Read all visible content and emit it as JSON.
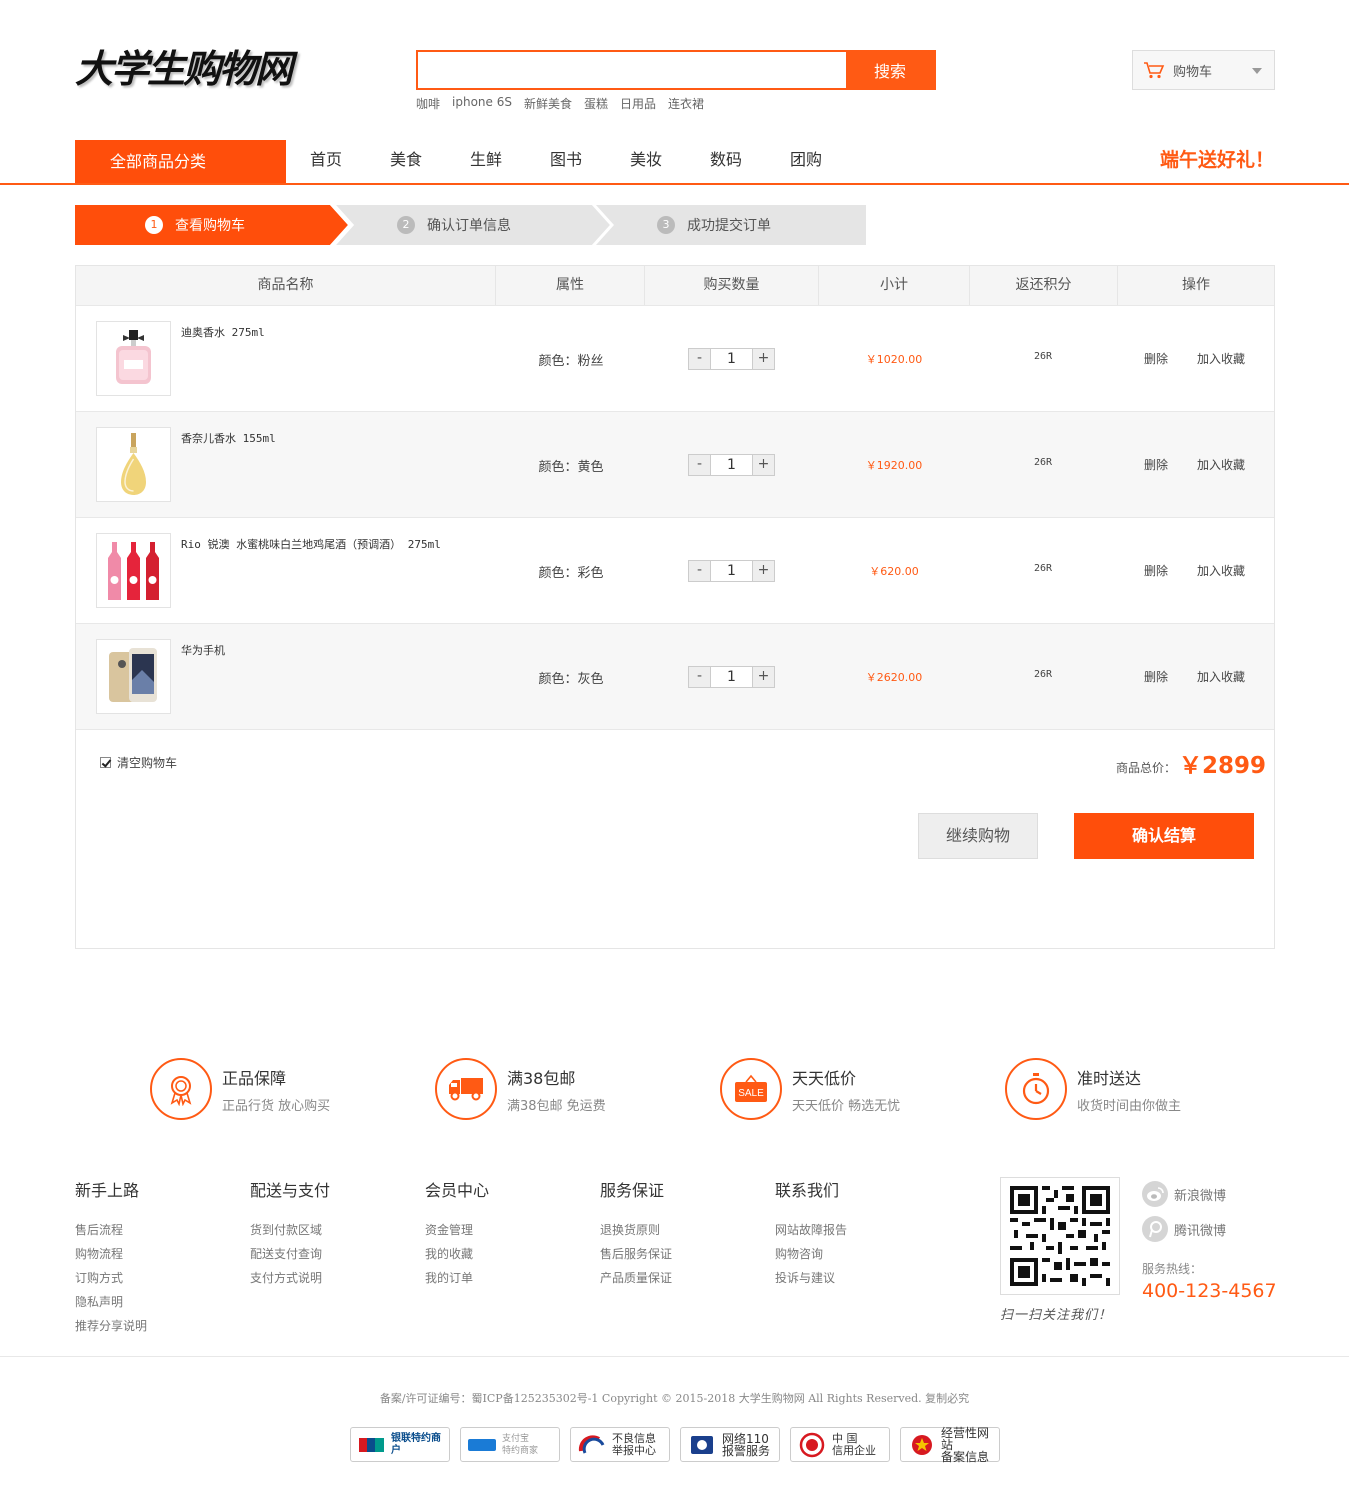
{
  "header": {
    "logo": "大学生购物网",
    "search_placeholder": "",
    "search_button": "搜索",
    "hot_words": [
      "咖啡",
      "iphone 6S",
      "新鲜美食",
      "蛋糕",
      "日用品",
      "连衣裙"
    ],
    "cart_label": "购物车"
  },
  "nav": {
    "all_categories": "全部商品分类",
    "items": [
      "首页",
      "美食",
      "生鲜",
      "图书",
      "美妆",
      "数码",
      "团购"
    ],
    "promo": "端午送好礼！"
  },
  "steps": [
    {
      "num": "1",
      "label": "查看购物车"
    },
    {
      "num": "2",
      "label": "确认订单信息"
    },
    {
      "num": "3",
      "label": "成功提交订单"
    }
  ],
  "cart": {
    "columns": [
      "商品名称",
      "属性",
      "购买数量",
      "小计",
      "返还积分",
      "操作"
    ],
    "items": [
      {
        "name": "迪奥香水 275ml",
        "attr": "颜色：粉丝",
        "qty": "1",
        "subtotal": "￥1020.00",
        "points": "26R",
        "delete": "删除",
        "favorite": "加入收藏"
      },
      {
        "name": "香奈儿香水 155ml",
        "attr": "颜色：黄色",
        "qty": "1",
        "subtotal": "￥1920.00",
        "points": "26R",
        "delete": "删除",
        "favorite": "加入收藏"
      },
      {
        "name": "Rio 锐澳 水蜜桃味白兰地鸡尾酒（预调酒） 275ml",
        "attr": "颜色：彩色",
        "qty": "1",
        "subtotal": "￥620.00",
        "points": "26R",
        "delete": "删除",
        "favorite": "加入收藏"
      },
      {
        "name": "华为手机",
        "attr": "颜色：灰色",
        "qty": "1",
        "subtotal": "￥2620.00",
        "points": "26R",
        "delete": "删除",
        "favorite": "加入收藏"
      }
    ],
    "minus": "-",
    "plus": "+",
    "clear_label": "清空购物车",
    "total_label": "商品总价：",
    "total_value": "￥2899",
    "continue_button": "继续购物",
    "confirm_button": "确认结算"
  },
  "guarantees": [
    {
      "title": "正品保障",
      "sub": "正品行货 放心购买",
      "icon": "medal-icon"
    },
    {
      "title": "满38包邮",
      "sub": "满38包邮 免运费",
      "icon": "truck-icon"
    },
    {
      "title": "天天低价",
      "sub": "天天低价 畅选无忧",
      "icon": "sale-tag-icon",
      "icon_text": "SALE"
    },
    {
      "title": "准时送达",
      "sub": "收货时间由你做主",
      "icon": "stopwatch-icon"
    }
  ],
  "footer": {
    "columns": [
      {
        "title": "新手上路",
        "links": [
          "售后流程",
          "购物流程",
          "订购方式",
          "隐私声明",
          "推荐分享说明"
        ]
      },
      {
        "title": "配送与支付",
        "links": [
          "货到付款区域",
          "配送支付查询",
          "支付方式说明"
        ]
      },
      {
        "title": "会员中心",
        "links": [
          "资金管理",
          "我的收藏",
          "我的订单"
        ]
      },
      {
        "title": "服务保证",
        "links": [
          "退换货原则",
          "售后服务保证",
          "产品质量保证"
        ]
      },
      {
        "title": "联系我们",
        "links": [
          "网站故障报告",
          "购物咨询",
          "投诉与建议"
        ]
      }
    ],
    "qr_caption": "扫一扫关注我们！",
    "weibo_sina": "新浪微博",
    "weibo_tencent": "腾讯微博",
    "hotline_label": "服务热线：",
    "hotline": "400-123-4567",
    "copyright": "备案/许可证编号：蜀ICP备125235302号-1 Copyright © 2015-2018 大学生购物网 All Rights Reserved. 复制必究",
    "badges": [
      {
        "line1": "银联特约商户",
        "line2": ""
      },
      {
        "line1": "支付宝",
        "line2": "特约商家"
      },
      {
        "line1": "不良信息",
        "line2": "举报中心"
      },
      {
        "line1": "网络110",
        "line2": "报警服务"
      },
      {
        "line1": "中 国",
        "line2": "信用企业"
      },
      {
        "line1": "经营性网站",
        "line2": "备案信息"
      }
    ]
  },
  "colors": {
    "accent": "#ff5a14",
    "accent_dark": "#ff4e0b"
  }
}
